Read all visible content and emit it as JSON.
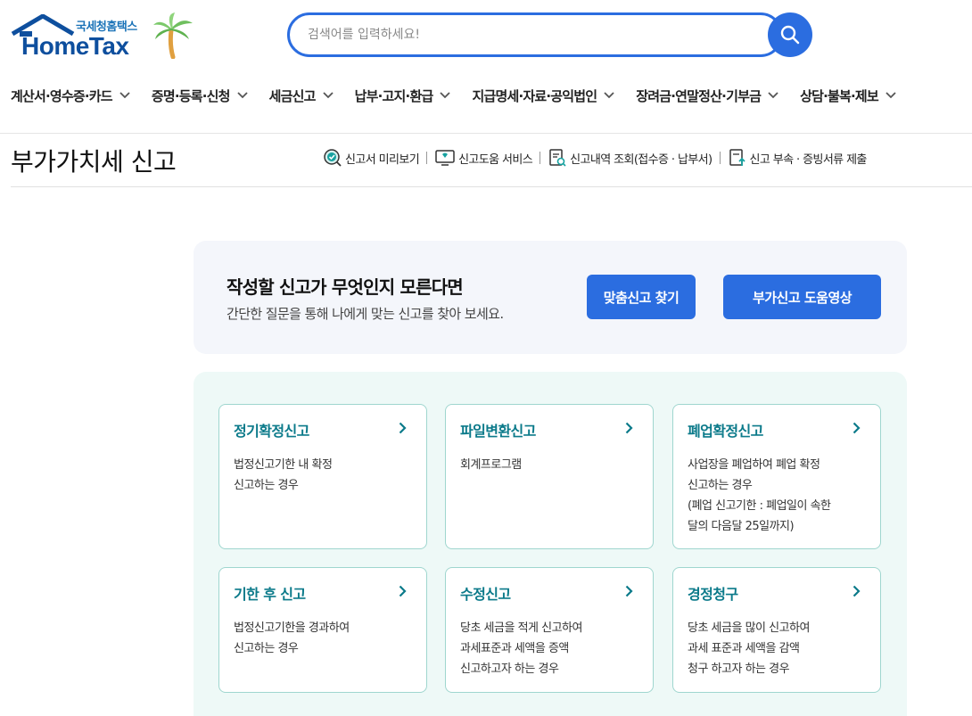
{
  "logo": {
    "subtitle": "국세청홈택스",
    "name": "HomeTax"
  },
  "search": {
    "placeholder": "검색어를 입력하세요!"
  },
  "gnb": [
    {
      "label": "계산서·영수증·카드"
    },
    {
      "label": "증명·등록·신청"
    },
    {
      "label": "세금신고"
    },
    {
      "label": "납부·고지·환급"
    },
    {
      "label": "지급명세·자료·공익법인"
    },
    {
      "label": "장려금·연말정산·기부금"
    },
    {
      "label": "상담·불복·제보"
    }
  ],
  "page": {
    "title": "부가가치세 신고"
  },
  "quick_links": [
    {
      "label": "신고서 미리보기",
      "icon": "preview-check-icon"
    },
    {
      "label": "신고도움 서비스",
      "icon": "monitor-help-icon"
    },
    {
      "label": "신고내역 조회(접수증 · 납부서)",
      "icon": "document-search-icon"
    },
    {
      "label": "신고 부속 · 증빙서류 제출",
      "icon": "document-upload-icon"
    }
  ],
  "banner": {
    "title": "작성할 신고가 무엇인지 모른다면",
    "description": "간단한 질문을 통해 나에게 맞는 신고를 찾아 보세요.",
    "button_find": "맞춤신고 찾기",
    "button_video": "부가신고 도움영상"
  },
  "cards": [
    {
      "title": "정기확정신고",
      "lines": [
        "법정신고기한 내 확정",
        "신고하는 경우"
      ]
    },
    {
      "title": "파일변환신고",
      "lines": [
        "회계프로그램"
      ]
    },
    {
      "title": "폐업확정신고",
      "lines": [
        "사업장을 폐업하여 폐업 확정",
        "신고하는 경우",
        "(폐업 신고기한 : 폐업일이 속한",
        "달의 다음달 25일까지)"
      ]
    },
    {
      "title": "기한 후 신고",
      "lines": [
        "법정신고기한을 경과하여",
        "신고하는 경우"
      ]
    },
    {
      "title": "수정신고",
      "lines": [
        "당초 세금을 적게 신고하여",
        "과세표준과 세액을 증액",
        "신고하고자 하는 경우"
      ]
    },
    {
      "title": "경정청구",
      "lines": [
        "당초 세금을 많이 신고하여",
        "과세 표준과 세액을 감액",
        "청구 하고자 하는 경우"
      ]
    }
  ],
  "colors": {
    "primary": "#2b6de0",
    "card_title": "#0b7a8a",
    "panel_bg": "#eef9f7",
    "banner_bg": "#f4f6fb"
  }
}
